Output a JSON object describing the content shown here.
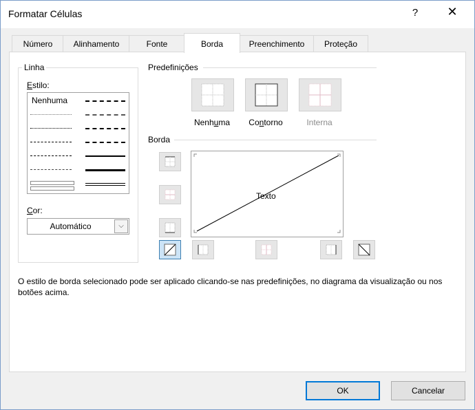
{
  "window": {
    "title": "Formatar Células",
    "help": "?",
    "close": "✕"
  },
  "tabs": [
    {
      "label": "Número"
    },
    {
      "label": "Alinhamento"
    },
    {
      "label": "Fonte"
    },
    {
      "label": "Borda",
      "active": true
    },
    {
      "label": "Preenchimento"
    },
    {
      "label": "Proteção"
    }
  ],
  "line_group": {
    "title": "Linha",
    "style_label_u": "E",
    "style_label_rest": "stilo:",
    "style_none": "Nenhuma",
    "color_label_u": "C",
    "color_label_rest": "or:",
    "color_value": "Automático"
  },
  "presets": {
    "title": "Predefinições",
    "none_a": "Nenh",
    "none_u": "u",
    "none_b": "ma",
    "outline_a": "Co",
    "outline_u": "n",
    "outline_b": "torno",
    "inside": "Interna"
  },
  "border": {
    "title": "Borda",
    "preview_text": "Texto"
  },
  "description": "O estilo de borda selecionado pode ser aplicado clicando-se nas predefinições, no diagrama da visualização ou nos botões acima.",
  "buttons": {
    "ok": "OK",
    "cancel": "Cancelar"
  },
  "colors": {
    "accent": "#0078d7",
    "selected_bg": "#cce4f7",
    "panel_border": "#d9d9d9"
  }
}
